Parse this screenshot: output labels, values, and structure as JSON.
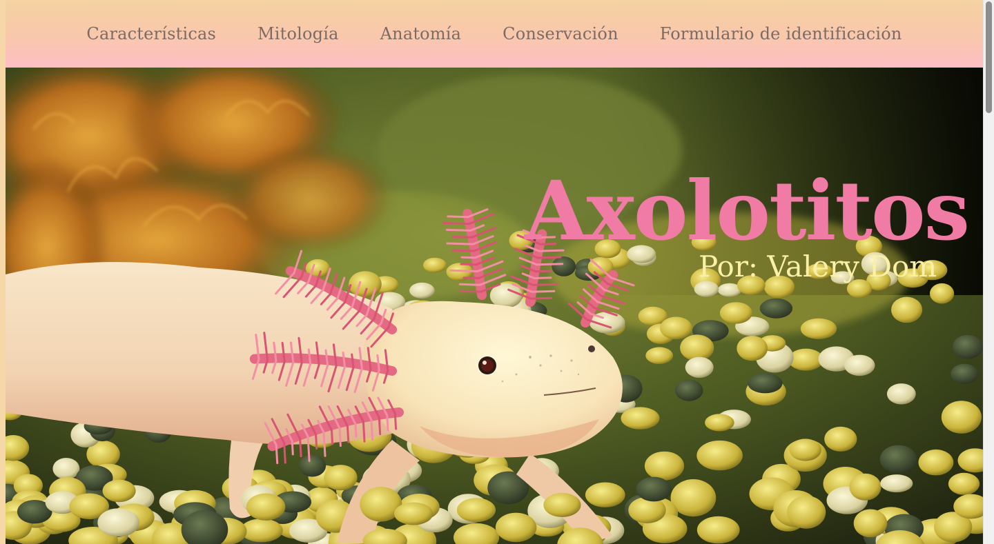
{
  "nav": {
    "items": [
      {
        "label": "Características"
      },
      {
        "label": "Mitología"
      },
      {
        "label": "Anatomía"
      },
      {
        "label": "Conservación"
      },
      {
        "label": "Formulario de identificación"
      }
    ]
  },
  "hero": {
    "title": "Axolotitos",
    "subtitle": "Por: Valery Dom",
    "image": "axolotl-photo"
  },
  "colors": {
    "nav_gradient_top": "#f4d2a1",
    "nav_gradient_bottom": "#fdbfc4",
    "nav_text": "#7b6b66",
    "title": "#f07ba5",
    "subtitle": "#fbf0a8"
  }
}
